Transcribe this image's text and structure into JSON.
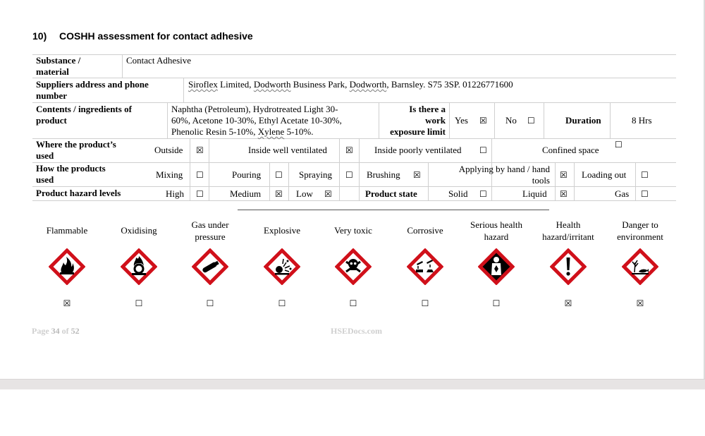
{
  "section": {
    "number": "10)",
    "title": "COSHH assessment for contact adhesive"
  },
  "substance": {
    "label_1": "Substance /",
    "label_2": "material",
    "value": "Contact Adhesive"
  },
  "supplier": {
    "label_1": "Suppliers address and phone",
    "label_2": "number",
    "company": "Siroflex",
    "after_company": " Limited, ",
    "place": "Dodworth",
    "after_place": " Business Park, ",
    "place2": "Dodworth",
    "after_place2": ", Barnsley. S75 3SP.   01226771600"
  },
  "contents": {
    "label_1": "Contents / ingredients of",
    "label_2": "product",
    "line_1": "Naphtha (Petroleum), Hydrotreated Light 30-",
    "line_2": "60%, Acetone 10-30%, Ethyl Acetate 10-30%,",
    "line_3_pre": "Phenolic Resin 5-10%, ",
    "line_3_wavy": "Xylene",
    "line_3_post": " 5-10%.",
    "exposure_1": "Is there a",
    "exposure_2": "work",
    "exposure_3": "exposure limit",
    "yes": "Yes",
    "yes_box": "☒",
    "no": "No",
    "no_box": "☐",
    "duration_label": "Duration",
    "duration_value": "8 Hrs"
  },
  "where_used": {
    "label_1": "Where the product’s",
    "label_2": "used",
    "outside": "Outside",
    "outside_box": "☒",
    "inside_well": "Inside well ventilated",
    "inside_well_box": "☒",
    "inside_poorly": "Inside poorly ventilated",
    "inside_poorly_box": "☐",
    "confined": "Confined space",
    "confined_box": "☐"
  },
  "how_used": {
    "label_1": "How the products",
    "label_2": "used",
    "mixing": "Mixing",
    "mixing_box": "☐",
    "pouring": "Pouring",
    "pouring_box": "☐",
    "spraying": "Spraying",
    "spraying_box": "☐",
    "brushing": "Brushing",
    "brushing_box": "☒",
    "applying_1": "Applying by hand / hand",
    "applying_2": "tools",
    "applying_box": "☒",
    "loading": "Loading out",
    "loading_box": "☐"
  },
  "hazard_levels": {
    "label": "Product hazard levels",
    "high": "High",
    "high_box": "☐",
    "medium": "Medium",
    "medium_box": "☒",
    "low": "Low",
    "low_box": "☒",
    "state_label": "Product state",
    "solid": "Solid",
    "solid_box": "☐",
    "liquid": "Liquid",
    "liquid_box": "☒",
    "gas": "Gas",
    "gas_box": "☐"
  },
  "hazards": [
    {
      "l1": "Flammable",
      "l2": "",
      "icon": "flammable-icon",
      "box": "☒"
    },
    {
      "l1": "Oxidising",
      "l2": "",
      "icon": "oxidising-icon",
      "box": "☐"
    },
    {
      "l1": "Gas under",
      "l2": "pressure",
      "icon": "gas-cylinder-icon",
      "box": "☐"
    },
    {
      "l1": "Explosive",
      "l2": "",
      "icon": "explosive-icon",
      "box": "☐"
    },
    {
      "l1": "Very toxic",
      "l2": "",
      "icon": "skull-icon",
      "box": "☐"
    },
    {
      "l1": "Corrosive",
      "l2": "",
      "icon": "corrosive-icon",
      "box": "☐"
    },
    {
      "l1": "Serious health",
      "l2": "hazard",
      "icon": "health-hazard-icon",
      "box": "☐"
    },
    {
      "l1": "Health",
      "l2": "hazard/irritant",
      "icon": "exclamation-icon",
      "box": "☒"
    },
    {
      "l1": "Danger to",
      "l2": "environment",
      "icon": "environment-icon",
      "box": "☒"
    }
  ],
  "footer": {
    "page_word": "Page ",
    "page": "34",
    "of_word": " of ",
    "total": "52",
    "site": "HSEDocs.com"
  },
  "colors": {
    "pictogram_border": "#d0101a",
    "footer_text": "#cfcfcf"
  }
}
